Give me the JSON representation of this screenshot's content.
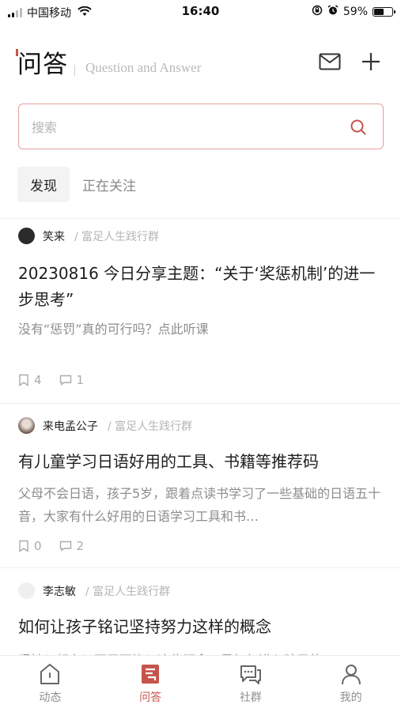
{
  "status_bar": {
    "carrier": "中国移动",
    "time": "16:40",
    "battery": "59%",
    "battery_level": 0.59
  },
  "header": {
    "title": "问答",
    "subtitle": "Question and Answer",
    "mail_icon": "mail-icon",
    "add_icon": "plus-icon"
  },
  "search": {
    "placeholder": "搜索",
    "icon": "search-icon"
  },
  "tabs": [
    {
      "label": "发现",
      "active": true
    },
    {
      "label": "正在关注",
      "active": false
    }
  ],
  "feed": [
    {
      "author": "笑来",
      "group": "/ 富足人生践行群",
      "title": "20230816 今日分享主题：“关于‘奖惩机制’的进一步思考”",
      "excerpt": "没有“惩罚”真的可行吗？点此听课",
      "bookmarks": "4",
      "comments": "1"
    },
    {
      "author": "来电孟公子",
      "group": "/ 富足人生践行群",
      "title": "有儿童学习日语好用的工具、书籍等推荐码",
      "excerpt": "父母不会日语，孩子5岁，跟着点读书学习了一些基础的日语五十音，大家有什么好用的日语学习工具和书…",
      "bookmarks": "0",
      "comments": "2"
    },
    {
      "author": "李志敏",
      "group": "/ 富足人生践行群",
      "title": "如何让孩子铭记坚持努力这样的概念",
      "excerpt": "坚持？努力？不屈不挠？这些概念，是如何进入孩子的"
    }
  ],
  "tabbar": [
    {
      "label": "动态",
      "icon": "home-icon"
    },
    {
      "label": "问答",
      "icon": "qa-icon",
      "active": true
    },
    {
      "label": "社群",
      "icon": "chat-icon"
    },
    {
      "label": "我的",
      "icon": "person-icon"
    }
  ],
  "colors": {
    "accent": "#c6544c",
    "search_border": "#e3a29c",
    "muted_text": "#8d8d8d"
  }
}
